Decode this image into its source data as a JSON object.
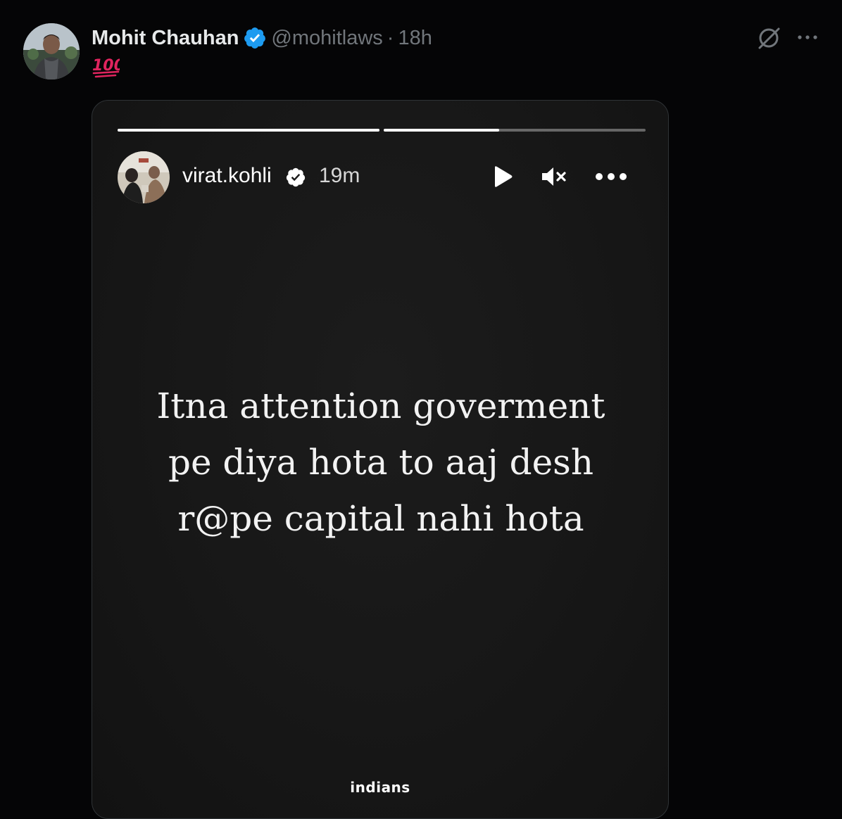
{
  "tweet": {
    "author": {
      "display_name": "Mohit Chauhan",
      "verified": true,
      "handle": "@mohitlaws",
      "separator": "·",
      "time": "18h"
    },
    "text_emoji": "💯",
    "icons": {
      "grok": "grok-icon",
      "more": "more-horizontal-icon",
      "verified": "verified-badge-icon"
    },
    "colors": {
      "background": "#050506",
      "verified_blue": "#1d9bf0",
      "name_text": "#e7e9ea",
      "secondary_text": "#71767b",
      "emoji_red": "#e0245e"
    }
  },
  "story": {
    "progress": [
      {
        "fraction": 1.0
      },
      {
        "fraction": 0.44
      }
    ],
    "username": "virat.kohli",
    "verified": true,
    "time": "19m",
    "controls": [
      "play-icon",
      "mute-icon",
      "more-horizontal-icon"
    ],
    "text": "Itna attention goverment\npe diya hota to aaj desh\nr@pe capital nahi hota",
    "watermark": "indians",
    "colors": {
      "background": "#171717",
      "text": "#f2f2f2",
      "progress_track": "rgba(255,255,255,0.35)",
      "progress_fill": "#ffffff"
    }
  }
}
